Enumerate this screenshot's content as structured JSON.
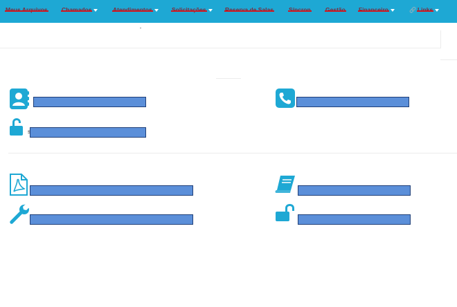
{
  "navbar": {
    "bg": "#1ea8d4",
    "items": [
      {
        "label": "Meus Arquivos",
        "caret": false
      },
      {
        "label": "Chamados",
        "caret": true
      },
      {
        "label": "Atendimentos",
        "caret": true
      },
      {
        "label": "Solicitações",
        "caret": true
      },
      {
        "label": "Reserva de Salas",
        "caret": false
      },
      {
        "label": "Síncron",
        "caret": false
      },
      {
        "label": "Gestão",
        "caret": false
      },
      {
        "label": "Financeiro",
        "caret": true
      },
      {
        "label": "Links",
        "caret": true,
        "icon": "link-icon"
      }
    ]
  },
  "profile": {
    "contact_name": "",
    "phone": "",
    "password_prefix": "s",
    "password": ""
  },
  "links": {
    "pdf_item": "",
    "book_item": "",
    "tools_item": "",
    "unlock_item": ""
  },
  "colors": {
    "icon": "#1ea8d4",
    "redaction_fill": "#5b8fd9",
    "redaction_border": "#1f3f78"
  }
}
